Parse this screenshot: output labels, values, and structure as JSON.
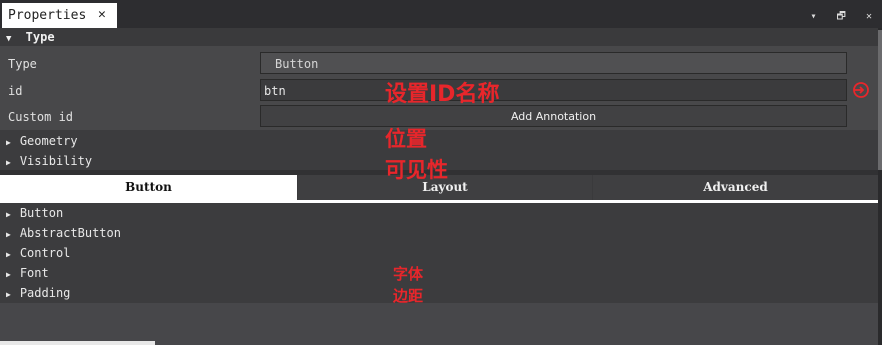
{
  "window": {
    "tab_title": "Properties",
    "tab_close": "✕",
    "ctrl_menu": "▾",
    "ctrl_float": "🗗",
    "ctrl_close": "✕"
  },
  "type_section": {
    "header": "Type",
    "rows": {
      "type_label": "Type",
      "type_value": "Button",
      "id_label": "id",
      "id_value": "btn",
      "custom_id_label": "Custom id",
      "add_annotation": "Add Annotation"
    }
  },
  "collapsed_groups": [
    "Geometry",
    "Visibility"
  ],
  "tabs": [
    "Button",
    "Layout",
    "Advanced"
  ],
  "active_tab": "Button",
  "button_groups": [
    "Button",
    "AbstractButton",
    "Control",
    "Font",
    "Padding"
  ],
  "annotations": {
    "id_note": "设置ID名称",
    "geometry_note": "位置",
    "visibility_note": "可见性",
    "font_note": "字体",
    "padding_note": "边距"
  },
  "colors": {
    "annotation": "#e8262b",
    "reset_icon": "#e8262b"
  }
}
